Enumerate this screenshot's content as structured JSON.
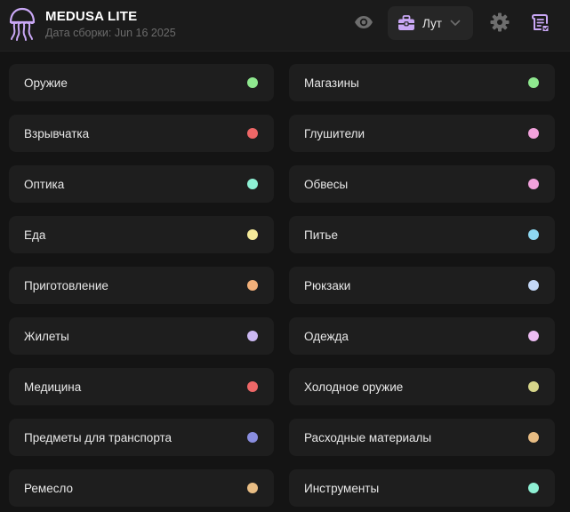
{
  "header": {
    "title": "MEDUSA LITE",
    "build_date": "Дата сборки: Jun 16 2025",
    "logo_icon": "jellyfish-icon",
    "visibility_icon": "eye-icon",
    "settings_icon": "gear-icon",
    "scripts_icon": "script-list-icon",
    "loot_select": {
      "icon": "briefcase-icon",
      "label": "Лут"
    },
    "accent": "#c9a7f5"
  },
  "categories": [
    {
      "label": "Оружие",
      "color": "#8fe88f"
    },
    {
      "label": "Магазины",
      "color": "#8fe88f"
    },
    {
      "label": "Взрывчатка",
      "color": "#ee6767"
    },
    {
      "label": "Глушители",
      "color": "#f2a2dc"
    },
    {
      "label": "Оптика",
      "color": "#8ef0d4"
    },
    {
      "label": "Обвесы",
      "color": "#f2a2dc"
    },
    {
      "label": "Еда",
      "color": "#f5ea9a"
    },
    {
      "label": "Питье",
      "color": "#8fd8f2"
    },
    {
      "label": "Приготовление",
      "color": "#f2b07a"
    },
    {
      "label": "Рюкзаки",
      "color": "#c4d8f7"
    },
    {
      "label": "Жилеты",
      "color": "#cbb8f2"
    },
    {
      "label": "Одежда",
      "color": "#ecbcf2"
    },
    {
      "label": "Медицина",
      "color": "#ee6767"
    },
    {
      "label": "Холодное оружие",
      "color": "#d6d58a"
    },
    {
      "label": "Предметы для транспорта",
      "color": "#8a8ee0"
    },
    {
      "label": "Расходные материалы",
      "color": "#e8bd84"
    },
    {
      "label": "Ремесло",
      "color": "#e8bd84"
    },
    {
      "label": "Инструменты",
      "color": "#8ef0d4"
    }
  ]
}
